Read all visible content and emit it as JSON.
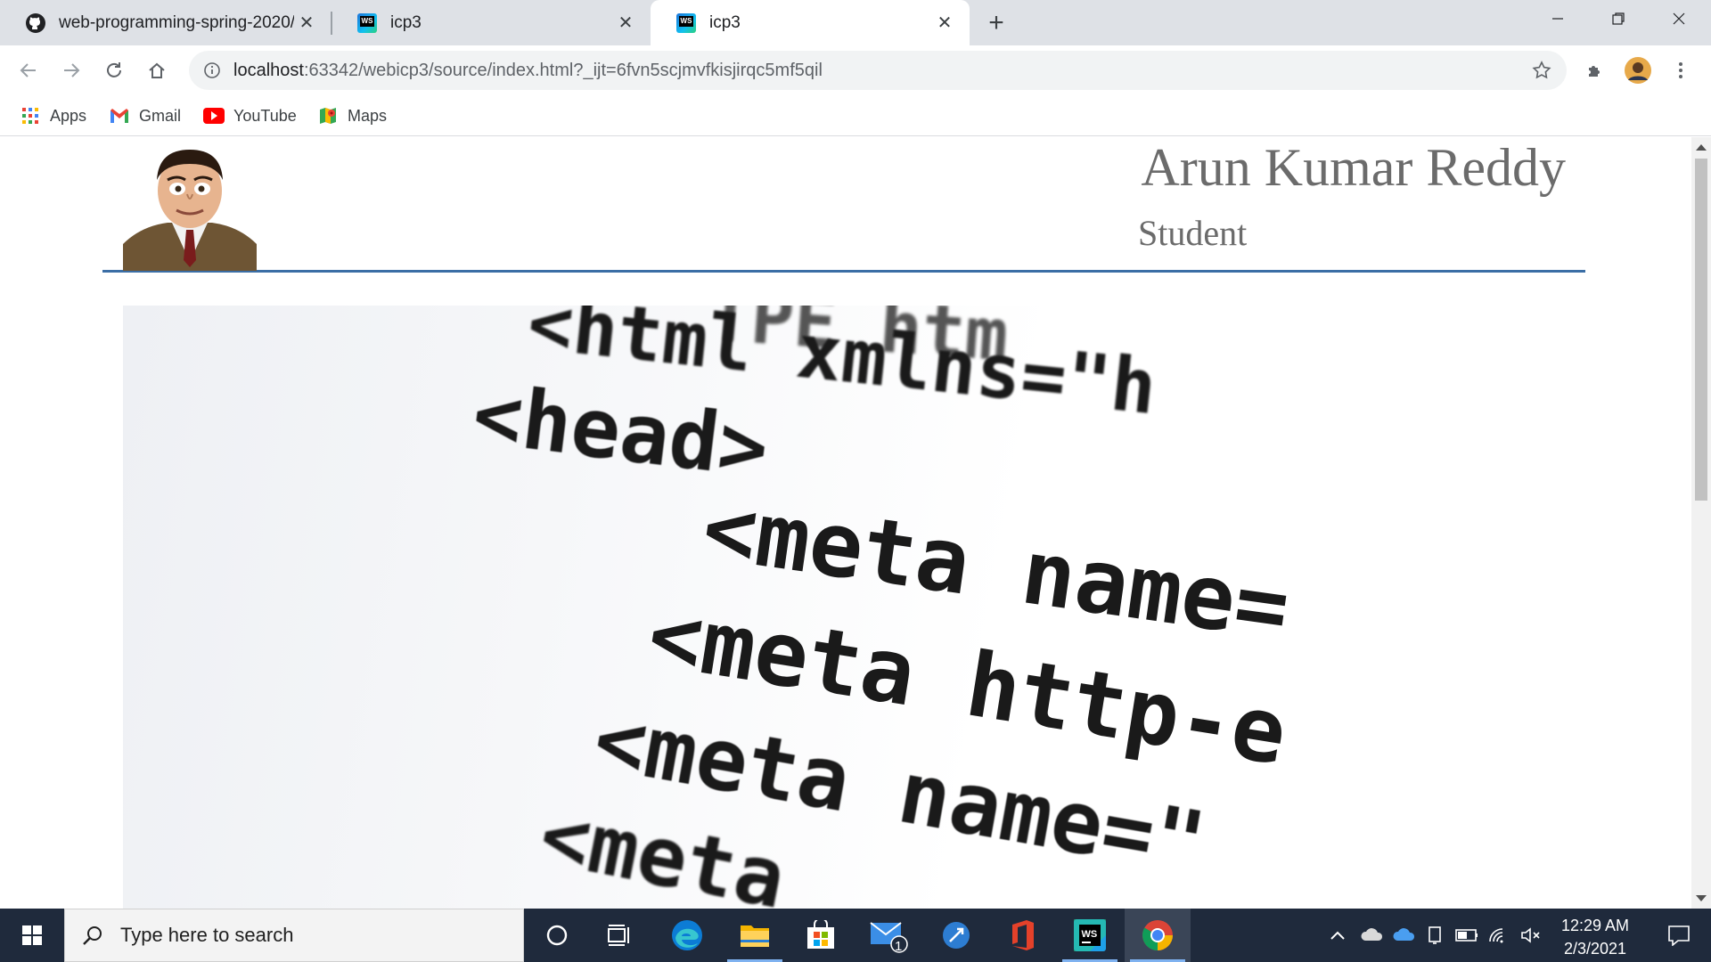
{
  "browser": {
    "tabs": [
      {
        "title": "web-programming-spring-2020/",
        "icon": "github-icon",
        "active": false
      },
      {
        "title": "icp3",
        "icon": "webstorm-icon",
        "active": false
      },
      {
        "title": "icp3",
        "icon": "webstorm-icon",
        "active": true
      }
    ],
    "url_host": "localhost",
    "url_rest": ":63342/webicp3/source/index.html?_ijt=6fvn5scjmvfkisjirqc5mf5qil",
    "bookmarks": [
      {
        "label": "Apps",
        "icon": "apps-grid-icon"
      },
      {
        "label": "Gmail",
        "icon": "gmail-icon"
      },
      {
        "label": "YouTube",
        "icon": "youtube-icon"
      },
      {
        "label": "Maps",
        "icon": "maps-icon"
      }
    ]
  },
  "page": {
    "name": "Arun Kumar Reddy",
    "role": "Student",
    "avatar": "profile-photo",
    "hero_code_lines": [
      "<html  xmlns=\"h",
      "<head>",
      "<meta  name=",
      "<meta  http-e",
      "<meta  name=\"",
      "<meta"
    ],
    "hero_fragments": [
      "TPE  htm"
    ]
  },
  "taskbar": {
    "search_placeholder": "Type here to search",
    "time": "12:29 AM",
    "date": "2/3/2021",
    "mail_badge": "1",
    "apps": [
      "cortana-icon",
      "task-view-icon",
      "edge-icon",
      "file-explorer-icon",
      "store-icon",
      "mail-icon",
      "app-icon",
      "office-icon",
      "webstorm-icon",
      "chrome-icon"
    ]
  },
  "colors": {
    "header_rule": "#3b6ea5",
    "name_text": "#6b6b6b",
    "taskbar": "#1f2a3c",
    "tab_strip": "#dee1e6"
  }
}
